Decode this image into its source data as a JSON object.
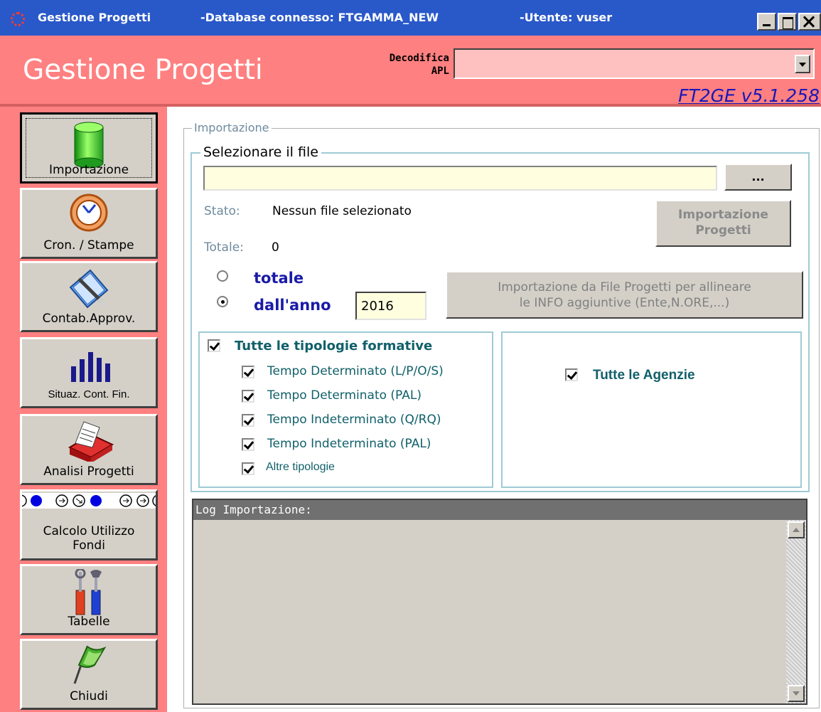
{
  "titlebar": {
    "app": "Gestione Progetti",
    "database": "-Database connesso: FTGAMMA_NEW",
    "user": "-Utente: vuser"
  },
  "header": {
    "title": "Gestione Progetti",
    "decodifica_label": "Decodifica\nAPL",
    "decodifica_value": "",
    "version": "FT2GE v5.1.258"
  },
  "sidebar": {
    "items": [
      {
        "label": "Importazione",
        "icon": "green-cylinder-icon",
        "active": true
      },
      {
        "label": "Cron. / Stampe",
        "icon": "clock-icon",
        "active": false
      },
      {
        "label": "Contab.Approv.",
        "icon": "ledger-pen-icon",
        "active": false
      },
      {
        "label": "Situaz. Cont. Fin.",
        "icon": "bar-chart-icon",
        "active": false
      },
      {
        "label": "Analisi Progetti",
        "icon": "card-file-icon",
        "active": false
      },
      {
        "label": "Calcolo Utilizzo\nFondi",
        "icon": "progress-dots-icon",
        "active": false
      },
      {
        "label": "Tabelle",
        "icon": "tools-icon",
        "active": false
      },
      {
        "label": "Chiudi",
        "icon": "green-flag-icon",
        "active": false
      }
    ]
  },
  "importazione": {
    "group_title": "Importazione",
    "file_group_title": "Selezionare il file",
    "file_path": "",
    "browse_label": "...",
    "stato_label": "Stato:",
    "stato_value": "Nessun file selezionato",
    "totale_label": "Totale:",
    "totale_value": "0",
    "import_button": "Importazione\nProgetti",
    "radio_totale": "totale",
    "radio_dallanno": "dall'anno",
    "year": "2016",
    "allinea_button": "Importazione da File Progetti per allineare\nle INFO aggiuntive (Ente,N.ORE,...)",
    "tipologie_all": "Tutte le tipologie formative",
    "tipologie": [
      "Tempo Determinato (L/P/O/S)",
      "Tempo Determinato (PAL)",
      "Tempo Indeterminato (Q/RQ)",
      "Tempo Indeterminato (PAL)",
      "Altre tipologie"
    ],
    "agenzie_all": "Tutte le Agenzie"
  },
  "log": {
    "title": "Log Importazione:"
  }
}
